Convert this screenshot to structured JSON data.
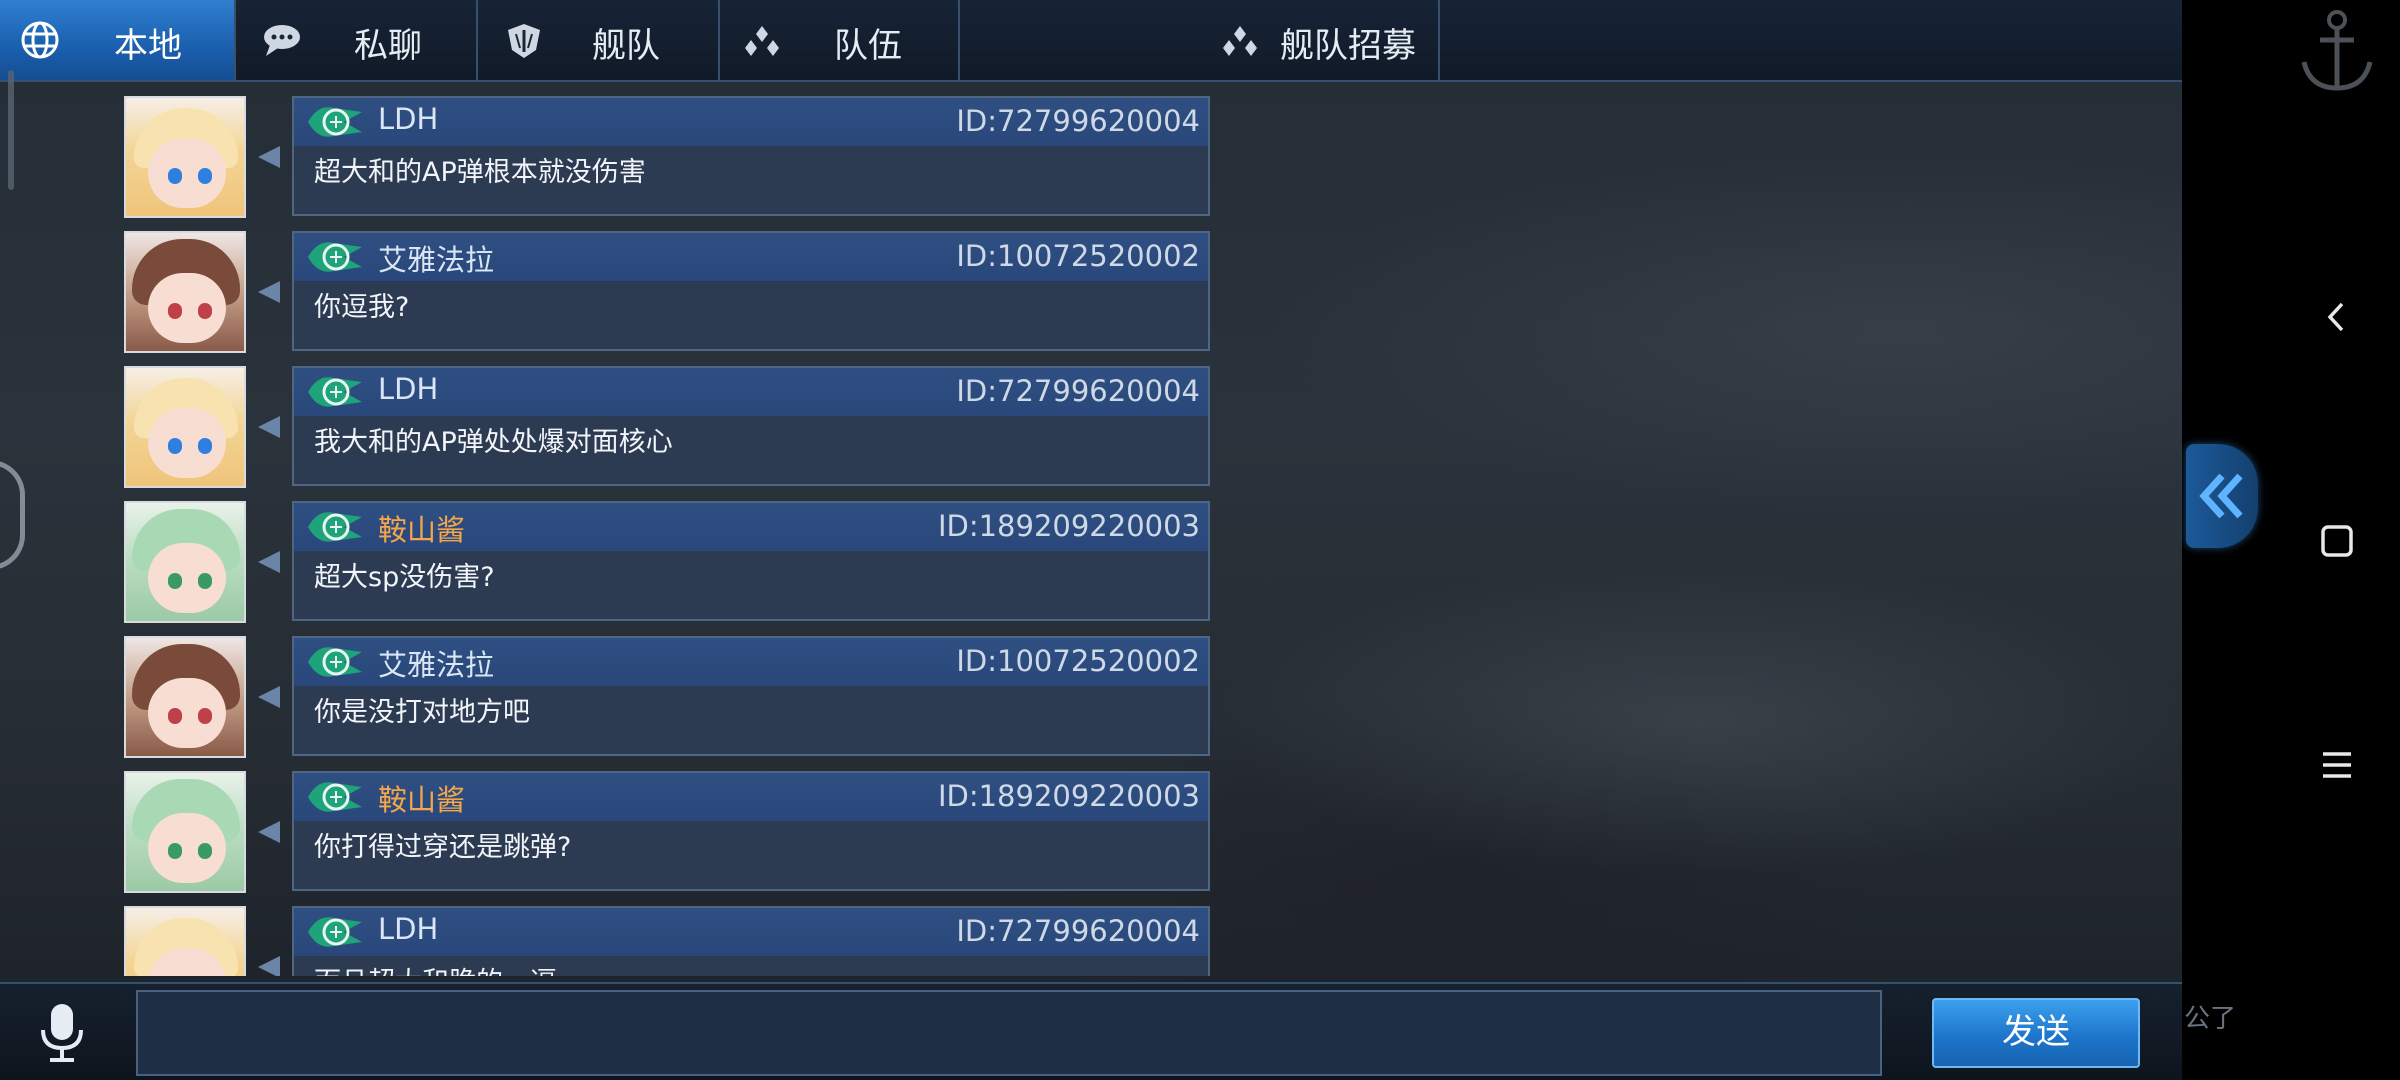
{
  "tabs": [
    {
      "label": "本地",
      "icon": "globe-icon",
      "active": true
    },
    {
      "label": "私聊",
      "icon": "chat-bubble-icon",
      "active": false
    },
    {
      "label": "舰队",
      "icon": "fleet-emblem-icon",
      "active": false
    },
    {
      "label": "队伍",
      "icon": "team-icon",
      "active": false
    },
    {
      "label": "舰队招募",
      "icon": "team-icon",
      "active": false
    }
  ],
  "messages": [
    {
      "name": "LDH",
      "id": "ID:72799620004",
      "text": "超大和的AP弹根本就没伤害",
      "avatar": "blond-girl",
      "name_color": "#dbe6f5"
    },
    {
      "name": "艾雅法拉",
      "id": "ID:10072520002",
      "text": "你逗我?",
      "avatar": "brown-girl",
      "name_color": "#dbe6f5"
    },
    {
      "name": "LDH",
      "id": "ID:72799620004",
      "text": "我大和的AP弹处处爆对面核心",
      "avatar": "blond-girl",
      "name_color": "#dbe6f5"
    },
    {
      "name": "鞍山酱",
      "id": "ID:189209220003",
      "text": "超大sp没伤害?",
      "avatar": "green-girl",
      "name_color": "#f5a64a"
    },
    {
      "name": "艾雅法拉",
      "id": "ID:10072520002",
      "text": "你是没打对地方吧",
      "avatar": "brown-girl",
      "name_color": "#dbe6f5"
    },
    {
      "name": "鞍山酱",
      "id": "ID:189209220003",
      "text": "你打得过穿还是跳弹?",
      "avatar": "green-girl",
      "name_color": "#f5a64a"
    },
    {
      "name": "LDH",
      "id": "ID:72799620004",
      "text": "而且超大和脆的一逼",
      "avatar": "blond-girl",
      "name_color": "#dbe6f5"
    }
  ],
  "input": {
    "value": "",
    "placeholder": ""
  },
  "send_label": "发送",
  "corner_text": "公了",
  "colors": {
    "accent": "#1d76cb",
    "orange_name": "#f5a64a",
    "bubble_header": "#2f4f82"
  }
}
